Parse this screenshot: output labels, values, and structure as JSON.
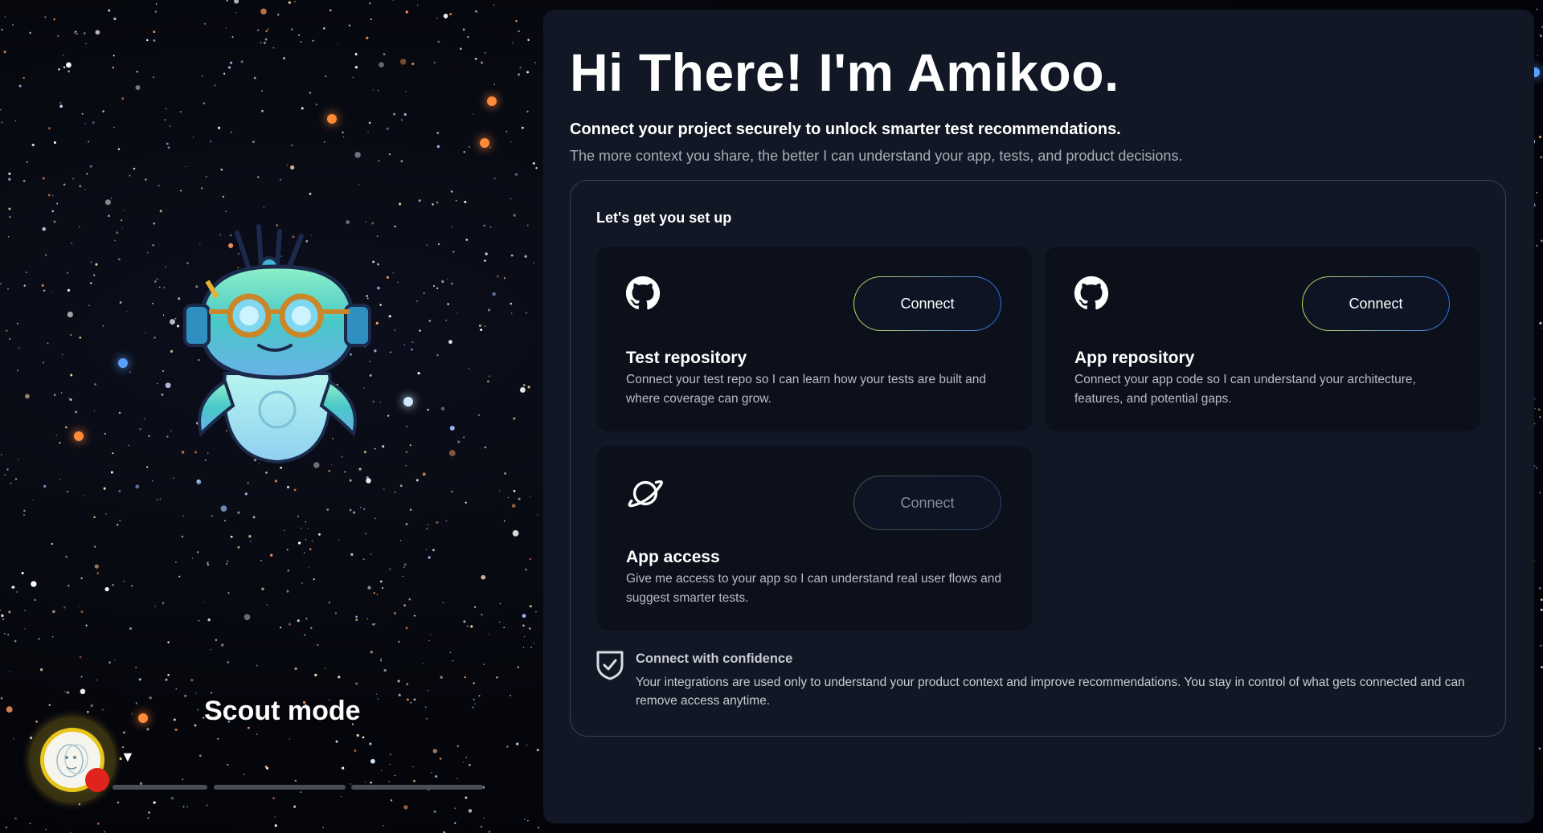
{
  "colors": {
    "panel_bg": "#111724",
    "card_bg": "#0c101a",
    "button_gradient_start": "#c6e05a",
    "button_gradient_end": "#2f6df0",
    "record_dot": "#e0231b",
    "avatar_ring": "#e8c51a"
  },
  "scout": {
    "title": "Scout mode",
    "avatar_icon": "face-avatar-icon",
    "record_icon": "record-dot-icon",
    "caret": "▼",
    "progress_segments": 3
  },
  "hero": {
    "title": "Hi There! I'm Amikoo.",
    "subtitle": "Connect your project securely to unlock smarter test recommendations.",
    "description": "The more context you share, the better I can understand your app, tests, and product decisions."
  },
  "setup": {
    "title": "Let's get you set up",
    "cards": [
      {
        "icon": "github-icon",
        "title": "Test repository",
        "description": "Connect your test repo so I can learn how your tests are built and where coverage can grow.",
        "button_label": "Connect",
        "enabled": true
      },
      {
        "icon": "github-icon",
        "title": "App repository",
        "description": "Connect your app code so I can understand your architecture, features, and potential gaps.",
        "button_label": "Connect",
        "enabled": true
      },
      {
        "icon": "planet-icon",
        "title": "App access",
        "description": "Give me access to your app so I can understand real user flows and suggest smarter tests.",
        "button_label": "Connect",
        "enabled": false
      }
    ],
    "confidence": {
      "icon": "shield-check-icon",
      "title": "Connect with confidence",
      "description": "Your integrations are used only to understand your product context and improve recommendations. You stay in control of what gets connected and can remove access anytime."
    }
  }
}
